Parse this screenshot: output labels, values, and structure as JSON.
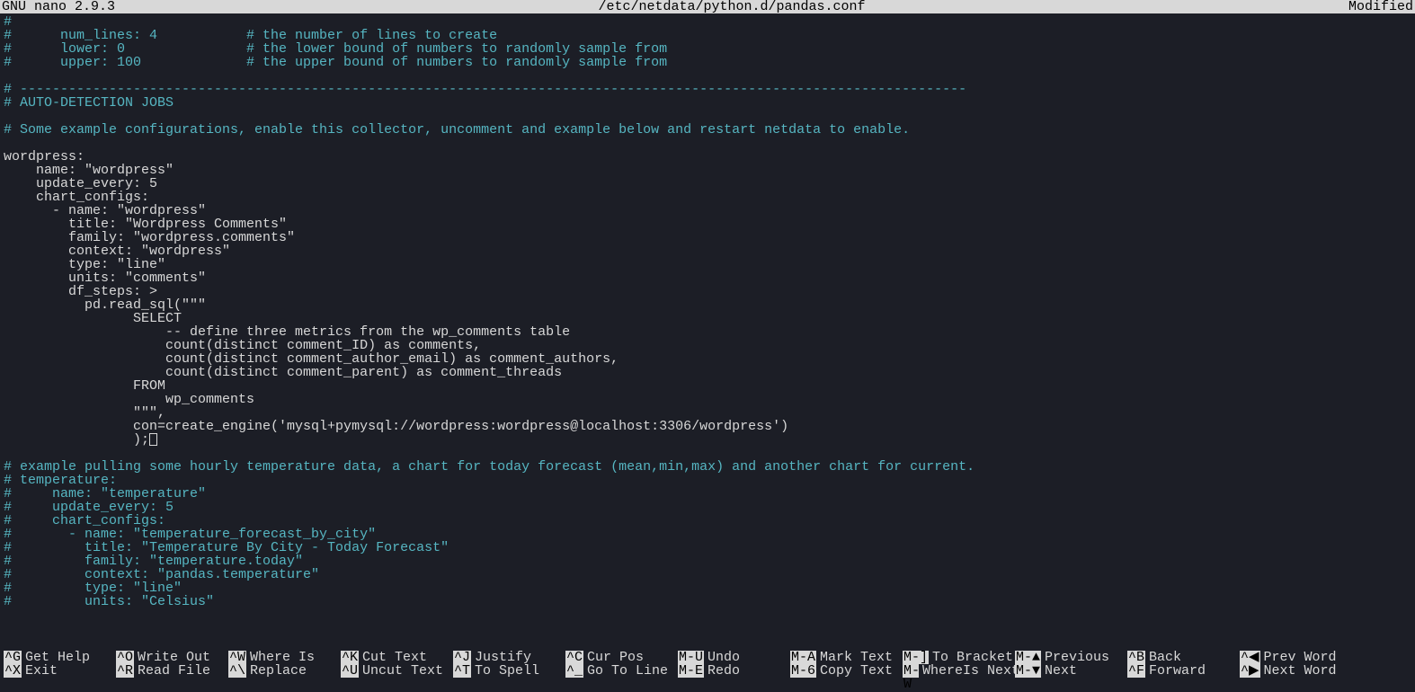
{
  "titlebar": {
    "left": "  GNU nano 2.9.3",
    "center": "/etc/netdata/python.d/pandas.conf",
    "right": "Modified "
  },
  "editor_lines": [
    {
      "class": "comment",
      "text": "#"
    },
    {
      "class": "comment",
      "text": "#      num_lines: 4           # the number of lines to create"
    },
    {
      "class": "comment",
      "text": "#      lower: 0               # the lower bound of numbers to randomly sample from"
    },
    {
      "class": "comment",
      "text": "#      upper: 100             # the upper bound of numbers to randomly sample from"
    },
    {
      "class": "txt",
      "text": ""
    },
    {
      "class": "comment",
      "text": "# ---------------------------------------------------------------------------------------------------------------------"
    },
    {
      "class": "comment",
      "text": "# AUTO-DETECTION JOBS"
    },
    {
      "class": "txt",
      "text": ""
    },
    {
      "class": "comment",
      "text": "# Some example configurations, enable this collector, uncomment and example below and restart netdata to enable."
    },
    {
      "class": "txt",
      "text": ""
    },
    {
      "class": "txt",
      "text": "wordpress:"
    },
    {
      "class": "txt",
      "text": "    name: \"wordpress\""
    },
    {
      "class": "txt",
      "text": "    update_every: 5"
    },
    {
      "class": "txt",
      "text": "    chart_configs:"
    },
    {
      "class": "txt",
      "text": "      - name: \"wordpress\""
    },
    {
      "class": "txt",
      "text": "        title: \"Wordpress Comments\""
    },
    {
      "class": "txt",
      "text": "        family: \"wordpress.comments\""
    },
    {
      "class": "txt",
      "text": "        context: \"wordpress\""
    },
    {
      "class": "txt",
      "text": "        type: \"line\""
    },
    {
      "class": "txt",
      "text": "        units: \"comments\""
    },
    {
      "class": "txt",
      "text": "        df_steps: >"
    },
    {
      "class": "txt",
      "text": "          pd.read_sql(\"\"\""
    },
    {
      "class": "txt",
      "text": "                SELECT"
    },
    {
      "class": "txt",
      "text": "                    -- define three metrics from the wp_comments table"
    },
    {
      "class": "txt",
      "text": "                    count(distinct comment_ID) as comments,"
    },
    {
      "class": "txt",
      "text": "                    count(distinct comment_author_email) as comment_authors,"
    },
    {
      "class": "txt",
      "text": "                    count(distinct comment_parent) as comment_threads"
    },
    {
      "class": "txt",
      "text": "                FROM"
    },
    {
      "class": "txt",
      "text": "                    wp_comments"
    },
    {
      "class": "txt",
      "text": "                \"\"\","
    },
    {
      "class": "txt",
      "text": "                con=create_engine('mysql+pymysql://wordpress:wordpress@localhost:3306/wordpress')"
    },
    {
      "class": "txt",
      "text": "                );",
      "cursor": true
    },
    {
      "class": "txt",
      "text": ""
    },
    {
      "class": "comment",
      "text": "# example pulling some hourly temperature data, a chart for today forecast (mean,min,max) and another chart for current."
    },
    {
      "class": "comment",
      "text": "# temperature:"
    },
    {
      "class": "comment",
      "text": "#     name: \"temperature\""
    },
    {
      "class": "comment",
      "text": "#     update_every: 5"
    },
    {
      "class": "comment",
      "text": "#     chart_configs:"
    },
    {
      "class": "comment",
      "text": "#       - name: \"temperature_forecast_by_city\""
    },
    {
      "class": "comment",
      "text": "#         title: \"Temperature By City - Today Forecast\""
    },
    {
      "class": "comment",
      "text": "#         family: \"temperature.today\""
    },
    {
      "class": "comment",
      "text": "#         context: \"pandas.temperature\""
    },
    {
      "class": "comment",
      "text": "#         type: \"line\""
    },
    {
      "class": "comment",
      "text": "#         units: \"Celsius\""
    }
  ],
  "shortcuts_row1": [
    {
      "key": "^G",
      "desc": "Get Help"
    },
    {
      "key": "^O",
      "desc": "Write Out"
    },
    {
      "key": "^W",
      "desc": "Where Is"
    },
    {
      "key": "^K",
      "desc": "Cut Text"
    },
    {
      "key": "^J",
      "desc": "Justify"
    },
    {
      "key": "^C",
      "desc": "Cur Pos"
    },
    {
      "key": "M-U",
      "desc": "Undo"
    },
    {
      "key": "M-A",
      "desc": "Mark Text"
    },
    {
      "key": "M-]",
      "desc": "To Bracket"
    },
    {
      "key": "M-▲",
      "desc": "Previous"
    },
    {
      "key": "^B",
      "desc": "Back"
    },
    {
      "key": "^◀",
      "desc": "Prev Word"
    }
  ],
  "shortcuts_row2": [
    {
      "key": "^X",
      "desc": "Exit"
    },
    {
      "key": "^R",
      "desc": "Read File"
    },
    {
      "key": "^\\",
      "desc": "Replace"
    },
    {
      "key": "^U",
      "desc": "Uncut Text"
    },
    {
      "key": "^T",
      "desc": "To Spell"
    },
    {
      "key": "^_",
      "desc": "Go To Line"
    },
    {
      "key": "M-E",
      "desc": "Redo"
    },
    {
      "key": "M-6",
      "desc": "Copy Text"
    },
    {
      "key": "M-W",
      "desc": "WhereIs Next"
    },
    {
      "key": "M-▼",
      "desc": "Next"
    },
    {
      "key": "^F",
      "desc": "Forward"
    },
    {
      "key": "^▶",
      "desc": "Next Word"
    }
  ]
}
